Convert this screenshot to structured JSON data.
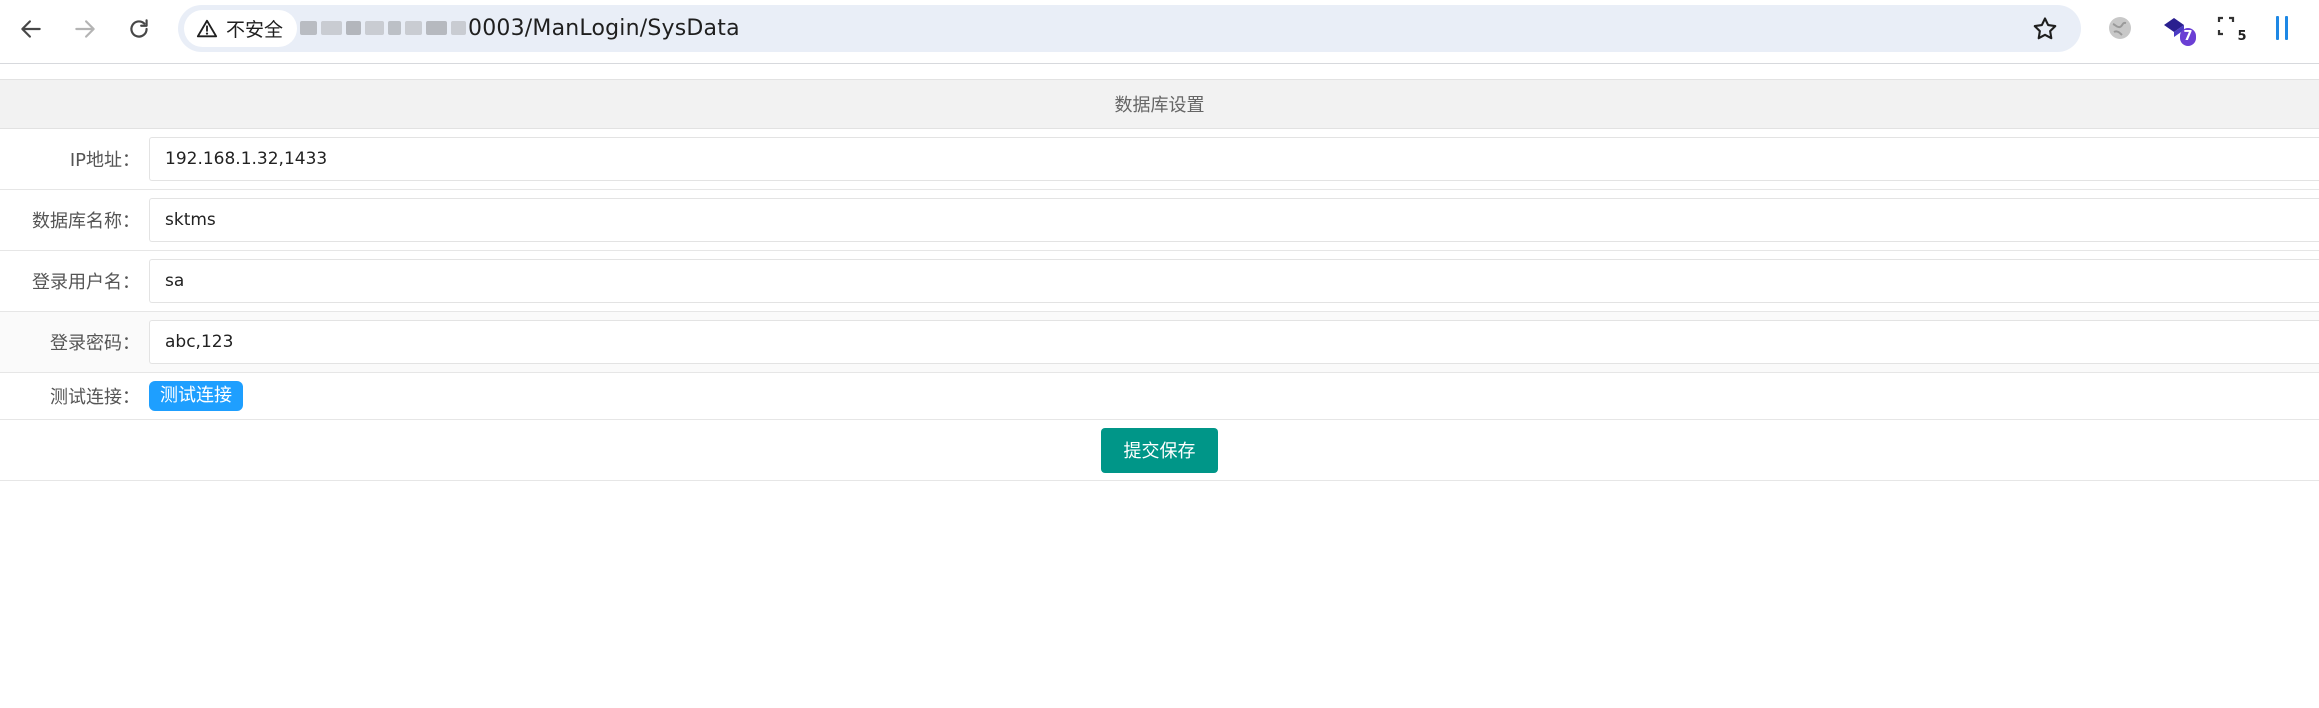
{
  "browser": {
    "security_label": "不安全",
    "url_visible": "0003/ManLogin/SysData",
    "extensions": [
      {
        "icon": "globe-icon",
        "badge": ""
      },
      {
        "icon": "cube-extension-icon",
        "badge": "7"
      },
      {
        "icon": "frame-extension-icon",
        "badge": "5"
      },
      {
        "icon": "bars-extension-icon",
        "badge": ""
      }
    ]
  },
  "form": {
    "title": "数据库设置",
    "fields": [
      {
        "label": "IP地址：",
        "value": "192.168.1.32,1433"
      },
      {
        "label": "数据库名称：",
        "value": "sktms"
      },
      {
        "label": "登录用户名：",
        "value": "sa"
      },
      {
        "label": "登录密码：",
        "value": "abc,123"
      }
    ],
    "test": {
      "label": "测试连接：",
      "button": "测试连接"
    },
    "submit_label": "提交保存"
  },
  "colors": {
    "test_button": "#1e9fff",
    "submit_button": "#009688",
    "header_bg": "#f2f2f2"
  }
}
